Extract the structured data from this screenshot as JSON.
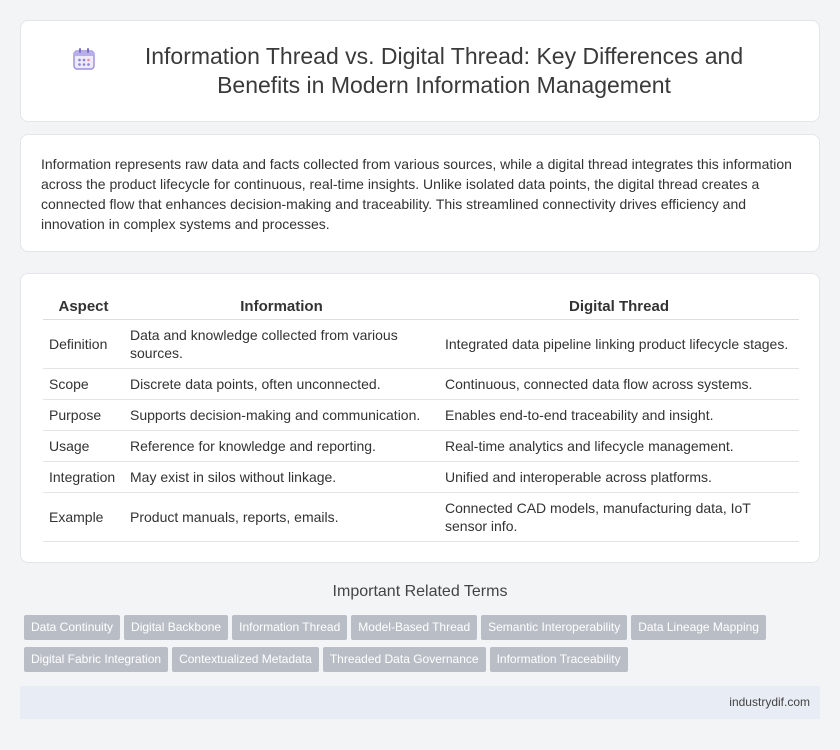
{
  "title": "Information Thread vs. Digital Thread: Key Differences and Benefits in Modern Information Management",
  "intro": "Information represents raw data and facts collected from various sources, while a digital thread integrates this information across the product lifecycle for continuous, real-time insights. Unlike isolated data points, the digital thread creates a connected flow that enhances decision-making and traceability. This streamlined connectivity drives efficiency and innovation in complex systems and processes.",
  "table": {
    "headers": [
      "Aspect",
      "Information",
      "Digital Thread"
    ],
    "rows": [
      [
        "Definition",
        "Data and knowledge collected from various sources.",
        "Integrated data pipeline linking product lifecycle stages."
      ],
      [
        "Scope",
        "Discrete data points, often unconnected.",
        "Continuous, connected data flow across systems."
      ],
      [
        "Purpose",
        "Supports decision-making and communication.",
        "Enables end-to-end traceability and insight."
      ],
      [
        "Usage",
        "Reference for knowledge and reporting.",
        "Real-time analytics and lifecycle management."
      ],
      [
        "Integration",
        "May exist in silos without linkage.",
        "Unified and interoperable across platforms."
      ],
      [
        "Example",
        "Product manuals, reports, emails.",
        "Connected CAD models, manufacturing data, IoT sensor info."
      ]
    ]
  },
  "related_title": "Important Related Terms",
  "related_terms": [
    "Data Continuity",
    "Digital Backbone",
    "Information Thread",
    "Model-Based Thread",
    "Semantic Interoperability",
    "Data Lineage Mapping",
    "Digital Fabric Integration",
    "Contextualized Metadata",
    "Threaded Data Governance",
    "Information Traceability"
  ],
  "footer": "industrydif.com",
  "icon": "calendar-icon",
  "colors": {
    "tag_bg": "#b9bec6",
    "footer_bg": "#e8ecf4",
    "icon_accent": "#8b7fd8"
  }
}
